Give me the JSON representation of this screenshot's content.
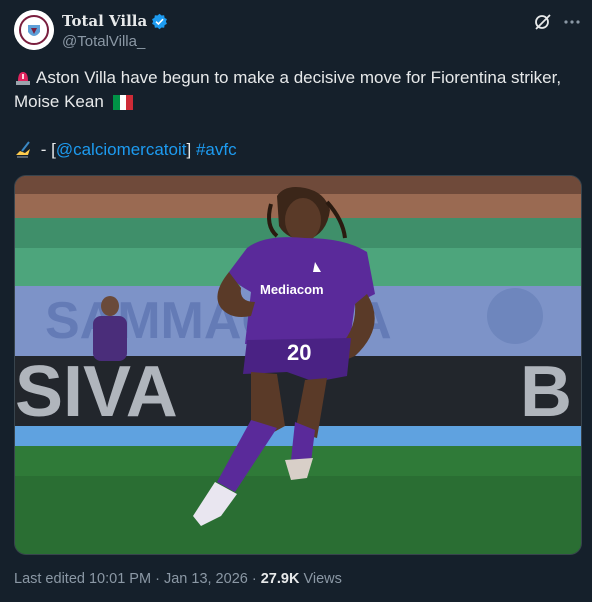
{
  "author": {
    "display_name": "Total Villa",
    "handle": "@TotalVilla_",
    "verified": true
  },
  "tweet": {
    "line1_text": "Aston Villa have begun to make a decisive move for Fiorentina striker, Moise Kean",
    "line1_emoji": "rotating-light",
    "flag_emoji": "italy-flag",
    "line2_prefix": " - [",
    "line2_mention": "@calciomercatoit",
    "line2_close": "]",
    "line2_hashtag": "#avfc",
    "line2_emoji": "writing-hand"
  },
  "image": {
    "alt": "",
    "jersey_number": "20",
    "sponsor": "Mediacom",
    "board_text": "SIVA",
    "board_letter": "B",
    "background_text": "SAMMACANA"
  },
  "footer": {
    "edited_label": "Last edited",
    "time": "10:01 PM",
    "separator": "·",
    "date": "Jan 13, 2026",
    "views_count": "27.9K",
    "views_label": "Views"
  },
  "colors": {
    "background": "#15202b",
    "text": "#e7e9ea",
    "secondary": "#8b98a5",
    "link": "#1d9bf0",
    "jersey": "#5a2a9a"
  },
  "icons": [
    "verified-badge-icon",
    "grok-icon",
    "more-icon"
  ]
}
